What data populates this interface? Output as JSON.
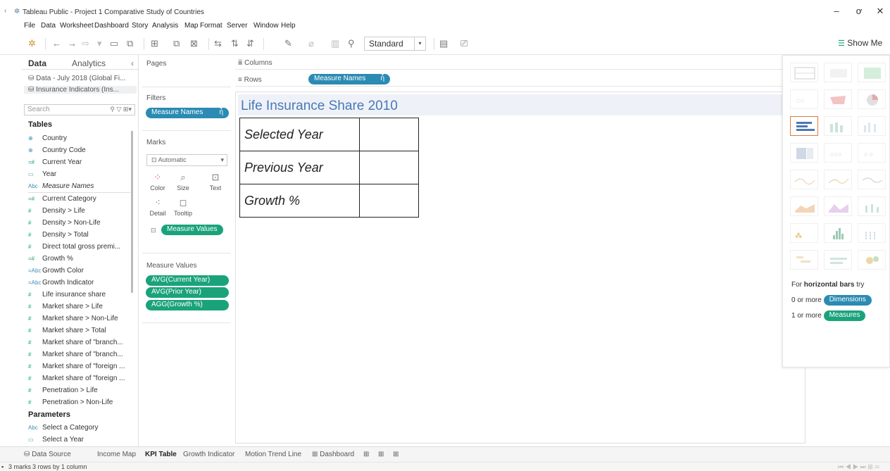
{
  "window": {
    "title": "Tableau Public - Project 1 Comparative Study of Countries",
    "minimize": "–",
    "restore": "ơ",
    "close": "✕"
  },
  "menu": [
    "File",
    "Data",
    "Worksheet",
    "Dashboard",
    "Story",
    "Analysis",
    "Map",
    "Format",
    "Server",
    "Window",
    "Help"
  ],
  "toolbar": {
    "fit_select": "Standard",
    "show_me_label": "Show Me"
  },
  "left_pane": {
    "tab_data": "Data",
    "tab_analytics": "Analytics",
    "sources": [
      "Data - July 2018 (Global Fi...",
      "Insurance Indicators (Ins..."
    ],
    "search_placeholder": "Search",
    "tables_heading": "Tables",
    "fields": [
      {
        "icon": "⊕",
        "name": "Country",
        "kind": "geo"
      },
      {
        "icon": "⊕",
        "name": "Country Code",
        "kind": "geo"
      },
      {
        "icon": "=#",
        "name": "Current Year",
        "kind": "calc"
      },
      {
        "icon": "▭",
        "name": "Year",
        "kind": "date"
      },
      {
        "icon": "Abc",
        "name": "Measure Names",
        "kind": "italic"
      },
      {
        "icon": "=#",
        "name": "Current Category",
        "kind": "calc"
      },
      {
        "icon": "#",
        "name": "Density > Life",
        "kind": "measure"
      },
      {
        "icon": "#",
        "name": "Density > Non-Life",
        "kind": "measure"
      },
      {
        "icon": "#",
        "name": "Density > Total",
        "kind": "measure"
      },
      {
        "icon": "#",
        "name": "Direct total gross premi...",
        "kind": "measure"
      },
      {
        "icon": "=#",
        "name": "Growth %",
        "kind": "calc"
      },
      {
        "icon": "=Abc",
        "name": "Growth Color",
        "kind": "calc"
      },
      {
        "icon": "=Abc",
        "name": "Growth Indicator",
        "kind": "calc"
      },
      {
        "icon": "#",
        "name": "Life insurance share",
        "kind": "measure"
      },
      {
        "icon": "#",
        "name": "Market share > Life",
        "kind": "measure"
      },
      {
        "icon": "#",
        "name": "Market share > Non-Life",
        "kind": "measure"
      },
      {
        "icon": "#",
        "name": "Market share > Total",
        "kind": "measure"
      },
      {
        "icon": "#",
        "name": "Market share of \"branch...",
        "kind": "measure"
      },
      {
        "icon": "#",
        "name": "Market share of \"branch...",
        "kind": "measure"
      },
      {
        "icon": "#",
        "name": "Market share of \"foreign ...",
        "kind": "measure"
      },
      {
        "icon": "#",
        "name": "Market share of \"foreign ...",
        "kind": "measure"
      },
      {
        "icon": "#",
        "name": "Penetration > Life",
        "kind": "measure"
      },
      {
        "icon": "#",
        "name": "Penetration > Non-Life",
        "kind": "measure"
      }
    ],
    "parameters_heading": "Parameters",
    "parameters": [
      {
        "icon": "Abc",
        "name": "Select a Category"
      },
      {
        "icon": "▭",
        "name": "Select a Year"
      }
    ]
  },
  "cards": {
    "pages": "Pages",
    "filters": "Filters",
    "filter_pill": "Measure Names",
    "marks": "Marks",
    "mark_type": "Automatic",
    "mark_buttons": [
      "Color",
      "Size",
      "Text",
      "Detail",
      "Tooltip"
    ],
    "marks_pill": "Measure Values",
    "measure_values_title": "Measure Values",
    "measure_values": [
      "AVG(Current Year)",
      "AVG(Prior Year)",
      "AGG(Growth %)"
    ]
  },
  "shelves": {
    "columns": "Columns",
    "rows": "Rows",
    "rows_pill": "Measure Names"
  },
  "view": {
    "title": "Life Insurance Share 2010",
    "rows": [
      {
        "label": "Selected Year",
        "value": ""
      },
      {
        "label": "Previous Year",
        "value": ""
      },
      {
        "label": "Growth %",
        "value": ""
      }
    ]
  },
  "show_me": {
    "hint_line1_prefix": "For ",
    "hint_line1_bold": "horizontal bars",
    "hint_line1_suffix": " try",
    "hint_line2_prefix": "0 or more",
    "hint_line2_pill": "Dimensions",
    "hint_line3_prefix": "1 or more",
    "hint_line3_pill": "Measures"
  },
  "bottom_tabs": [
    "Data Source",
    "Income Map",
    "KPI Table",
    "Growth Indicator",
    "Motion Trend Line",
    "Dashboard"
  ],
  "active_tab": "KPI Table",
  "status": {
    "marks": "3 marks",
    "rows": "3 rows by 1 column"
  },
  "colors": {
    "measure_pill": "#1aa37a",
    "dimension_pill": "#2b8bb2",
    "title": "#4a78b5",
    "selected_chart": "#e07a3c"
  }
}
